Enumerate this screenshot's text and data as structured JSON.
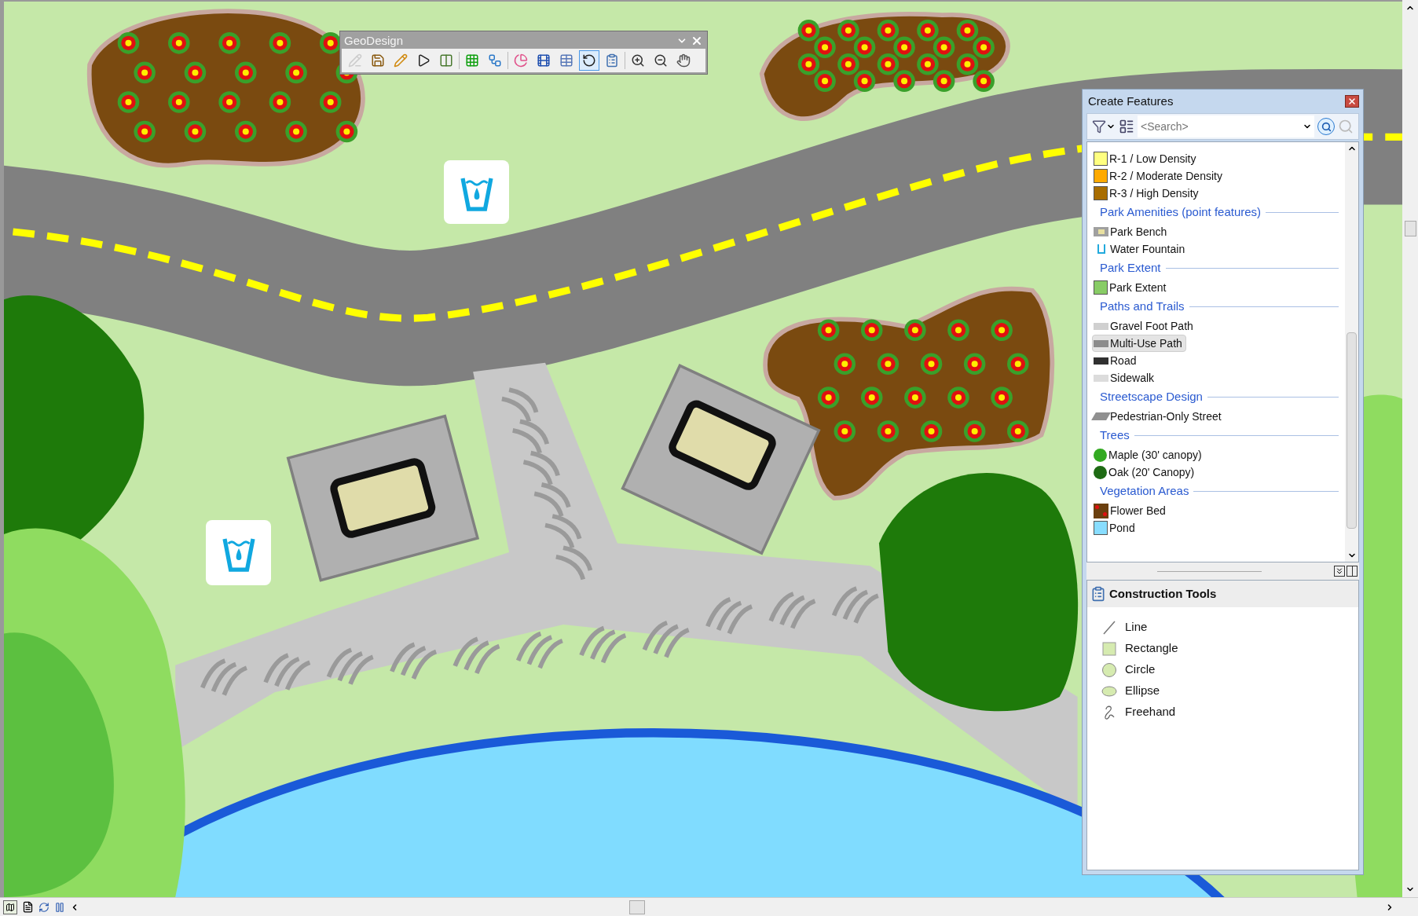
{
  "toolbar": {
    "title": "GeoDesign",
    "buttons": [
      {
        "selected": false,
        "disabled": true
      },
      {
        "selected": false,
        "disabled": false
      },
      {
        "selected": false,
        "disabled": false
      },
      {
        "selected": false,
        "disabled": false
      },
      {
        "selected": false,
        "disabled": false
      },
      {
        "selected": false,
        "disabled": false
      },
      {
        "selected": false,
        "disabled": false
      },
      {
        "selected": false,
        "disabled": false
      },
      {
        "selected": false,
        "disabled": false
      },
      {
        "selected": false,
        "disabled": false
      },
      {
        "selected": true,
        "disabled": false
      },
      {
        "selected": false,
        "disabled": false
      },
      {
        "selected": false,
        "disabled": false
      },
      {
        "selected": false,
        "disabled": false
      },
      {
        "selected": false,
        "disabled": false
      }
    ]
  },
  "create_features": {
    "title": "Create Features",
    "search": {
      "placeholder": "<Search>"
    },
    "groups": [
      {
        "items": [
          {
            "label": "R-1 / Low Density",
            "kind": "fill",
            "color": "#ffff80",
            "selected": false
          },
          {
            "label": "R-2 / Moderate Density",
            "kind": "fill",
            "color": "#ffaa00",
            "selected": false
          },
          {
            "label": "R-3 / High Density",
            "kind": "fill",
            "color": "#a86d00",
            "selected": false
          }
        ]
      },
      {
        "title": "Park Amenities (point features)",
        "items": [
          {
            "label": "Park Bench",
            "kind": "bench",
            "color": "#a0a0a0",
            "selected": false
          },
          {
            "label": "Water Fountain",
            "kind": "fountain",
            "color": "#22aadd",
            "selected": false
          }
        ]
      },
      {
        "title": "Park Extent",
        "items": [
          {
            "label": "Park Extent",
            "kind": "fill",
            "color": "#88cc66",
            "selected": false
          }
        ]
      },
      {
        "title": "Paths and Trails",
        "items": [
          {
            "label": "Gravel Foot Path",
            "kind": "line",
            "color": "#d0d0d0",
            "selected": false
          },
          {
            "label": "Multi-Use Path",
            "kind": "line",
            "color": "#8c8c8c",
            "selected": true
          },
          {
            "label": "Road",
            "kind": "line",
            "color": "#303030",
            "selected": false
          },
          {
            "label": "Sidewalk",
            "kind": "line",
            "color": "#dcdcdc",
            "selected": false
          }
        ]
      },
      {
        "title": "Streetscape Design",
        "items": [
          {
            "label": "Pedestrian-Only Street",
            "kind": "hatch",
            "color": "#909090",
            "selected": false
          }
        ]
      },
      {
        "title": "Trees",
        "items": [
          {
            "label": "Maple (30' canopy)",
            "kind": "dot",
            "color": "#33aa22",
            "selected": false
          },
          {
            "label": "Oak (20' Canopy)",
            "kind": "dot",
            "color": "#1e6a14",
            "selected": false
          }
        ]
      },
      {
        "title": "Vegetation Areas",
        "items": [
          {
            "label": "Flower Bed",
            "kind": "flower",
            "color": "#6b3f0e",
            "selected": false
          },
          {
            "label": "Pond",
            "kind": "fill",
            "color": "#88ddff",
            "selected": false
          }
        ]
      }
    ]
  },
  "construction_tools": {
    "title": "Construction Tools",
    "items": [
      {
        "label": "Line",
        "kind": "line"
      },
      {
        "label": "Rectangle",
        "kind": "rectangle"
      },
      {
        "label": "Circle",
        "kind": "circle"
      },
      {
        "label": "Ellipse",
        "kind": "ellipse"
      },
      {
        "label": "Freehand",
        "kind": "freehand"
      }
    ]
  }
}
